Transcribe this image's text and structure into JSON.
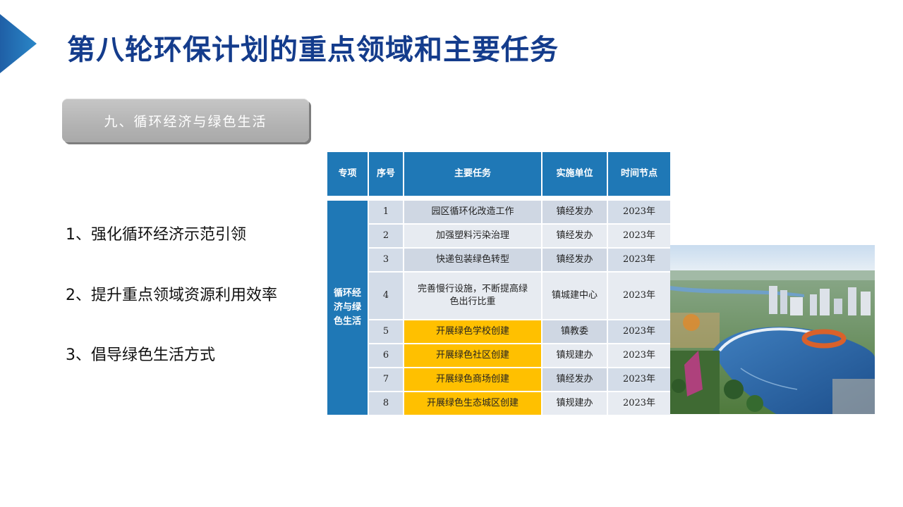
{
  "header": {
    "title": "第八轮环保计划的重点领域和主要任务"
  },
  "section": {
    "label": "九、循环经济与绿色生活"
  },
  "points": [
    "1、强化循环经济示范引领",
    "2、提升重点领域资源利用效率",
    "3、倡导绿色生活方式"
  ],
  "table": {
    "headers": [
      "专项",
      "序号",
      "主要任务",
      "实施单位",
      "时间节点"
    ],
    "category": "循环经济与绿色生活",
    "rows": [
      {
        "seq": "1",
        "task": "园区循环化改造工作",
        "unit": "镇经发办",
        "time": "2023年",
        "highlight": false
      },
      {
        "seq": "2",
        "task": "加强塑料污染治理",
        "unit": "镇经发办",
        "time": "2023年",
        "highlight": false
      },
      {
        "seq": "3",
        "task": "快递包装绿色转型",
        "unit": "镇经发办",
        "time": "2023年",
        "highlight": false
      },
      {
        "seq": "4",
        "task": "完善慢行设施，不断提高绿色出行比重",
        "unit": "镇城建中心",
        "time": "2023年",
        "highlight": false
      },
      {
        "seq": "5",
        "task": "开展绿色学校创建",
        "unit": "镇教委",
        "time": "2023年",
        "highlight": true
      },
      {
        "seq": "6",
        "task": "开展绿色社区创建",
        "unit": "镇规建办",
        "time": "2023年",
        "highlight": true
      },
      {
        "seq": "7",
        "task": "开展绿色商场创建",
        "unit": "镇经发办",
        "time": "2023年",
        "highlight": true
      },
      {
        "seq": "8",
        "task": "开展绿色生态城区创建",
        "unit": "镇规建办",
        "time": "2023年",
        "highlight": true
      }
    ]
  },
  "colors": {
    "title": "#143c8c",
    "table_header": "#1f78b6",
    "highlight": "#ffc000",
    "arrow": "#2a87c8"
  }
}
